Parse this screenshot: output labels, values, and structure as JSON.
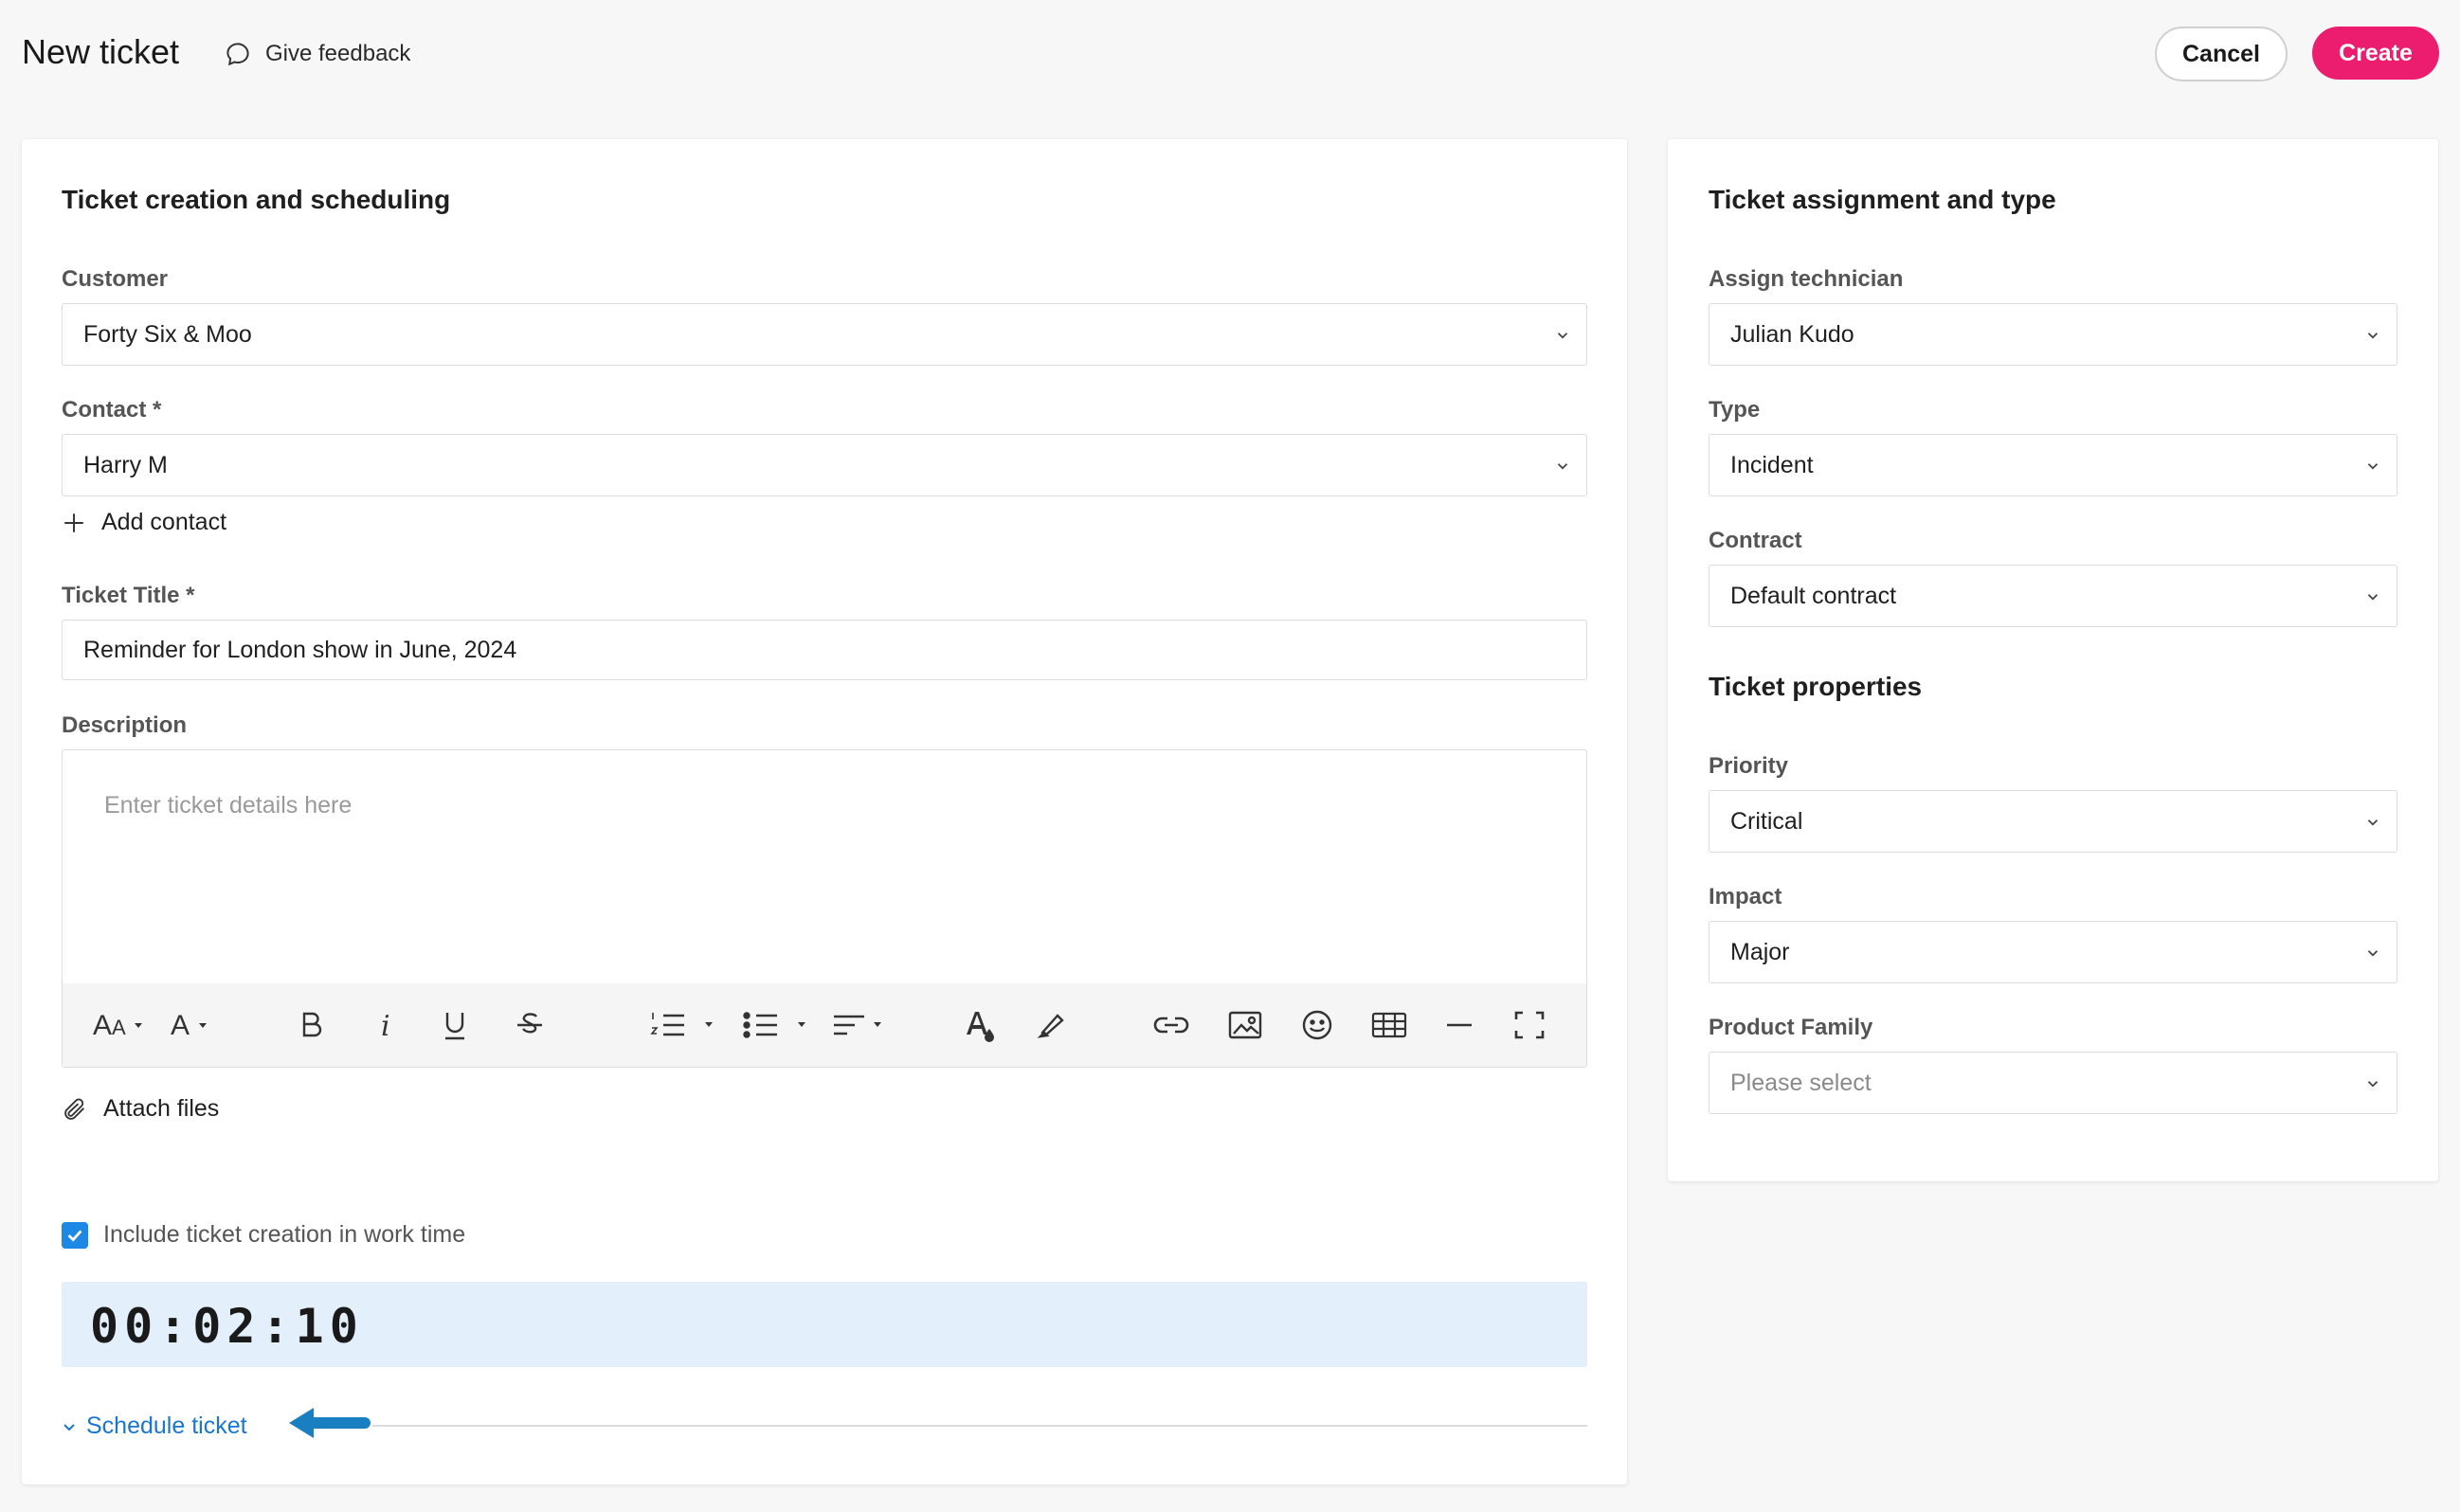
{
  "header": {
    "title": "New ticket",
    "feedback_label": "Give feedback",
    "cancel_label": "Cancel",
    "create_label": "Create"
  },
  "left": {
    "section_title": "Ticket creation and scheduling",
    "customer": {
      "label": "Customer",
      "value": "Forty Six & Moo"
    },
    "contact": {
      "label": "Contact *",
      "value": "Harry M"
    },
    "add_contact_label": "Add contact",
    "ticket_title": {
      "label": "Ticket Title *",
      "value": "Reminder for London show in June, 2024"
    },
    "description": {
      "label": "Description",
      "placeholder": "Enter ticket details here"
    },
    "toolbar_icons": [
      "font-size-icon",
      "font-family-icon",
      "bold-icon",
      "italic-icon",
      "underline-icon",
      "strikethrough-icon",
      "ordered-list-icon",
      "unordered-list-icon",
      "align-icon",
      "text-color-icon",
      "highlight-icon",
      "link-icon",
      "image-icon",
      "emoji-icon",
      "table-icon",
      "horizontal-rule-icon",
      "fullscreen-icon"
    ],
    "attach_label": "Attach files",
    "include_label": "Include ticket creation in work time",
    "include_checked": true,
    "timer": "00:02:10",
    "schedule_label": "Schedule ticket"
  },
  "right": {
    "section_title": "Ticket assignment and type",
    "technician": {
      "label": "Assign technician",
      "value": "Julian Kudo"
    },
    "type": {
      "label": "Type",
      "value": "Incident"
    },
    "contract": {
      "label": "Contract",
      "value": "Default contract"
    },
    "properties_title": "Ticket properties",
    "priority": {
      "label": "Priority",
      "value": "Critical"
    },
    "impact": {
      "label": "Impact",
      "value": "Major"
    },
    "product_family": {
      "label": "Product Family",
      "placeholder": "Please select"
    }
  },
  "colors": {
    "accent": "#ec1c6e",
    "link": "#1976d2",
    "checkbox": "#1e88e5",
    "timer_bg": "#e3f0fb",
    "arrow": "#1a7fc1"
  }
}
